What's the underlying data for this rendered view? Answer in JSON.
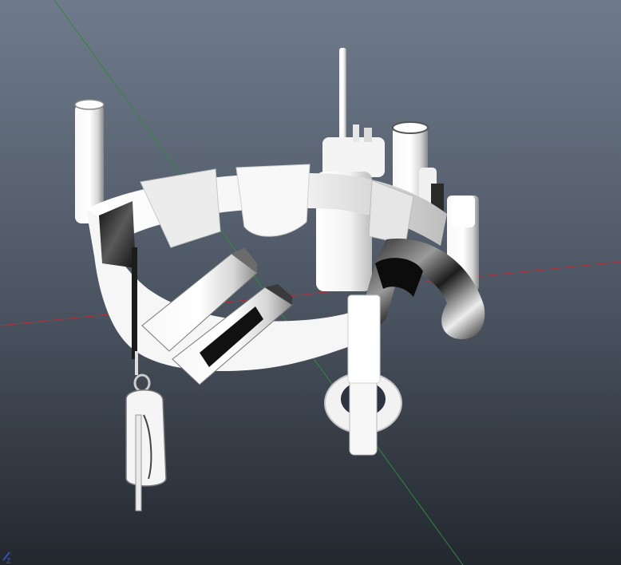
{
  "viewport": {
    "background_top": "#6f7b8c",
    "background_bottom": "#23282f",
    "grid_axis_x_color": "#b0303a",
    "grid_axis_z_color": "#2f8a3a",
    "corner_axis_label": "Z",
    "corner_axis_color": "#3b5bd6"
  },
  "model": {
    "base_color": "#f4f4f4",
    "shadow_color": "#8e8e8e",
    "dark_color": "#1a1a1a"
  }
}
